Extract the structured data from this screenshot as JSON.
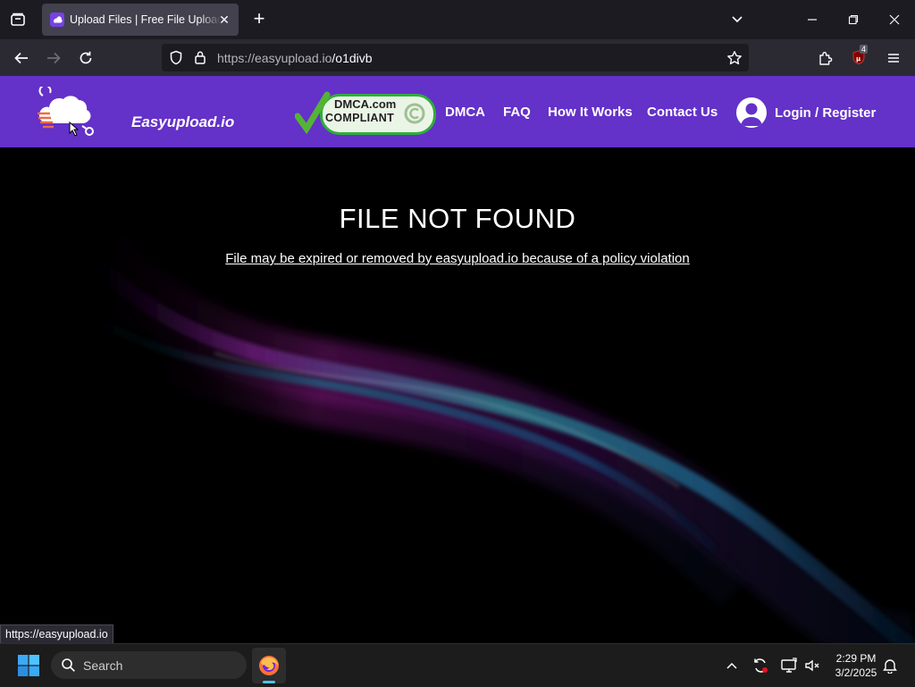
{
  "browser": {
    "tab_title": "Upload Files | Free File Upload and Transfer",
    "url_host": "https://easyupload.io",
    "url_path": "/o1divb",
    "extension_badge": "4",
    "status_url": "https://easyupload.io"
  },
  "site": {
    "brand": "Easyupload.io",
    "dmca_line1": "DMCA.com",
    "dmca_line2": "COMPLIANT",
    "nav": {
      "dmca": "DMCA",
      "faq": "FAQ",
      "how": "How It Works",
      "contact": "Contact Us",
      "login": "Login / Register"
    },
    "brand_color": "#6431c9"
  },
  "page": {
    "headline": "FILE NOT FOUND",
    "message": "File may be expired or removed by easyupload.io because of a policy violation"
  },
  "taskbar": {
    "search_label": "Search",
    "time": "2:29 PM",
    "date": "3/2/2025"
  }
}
